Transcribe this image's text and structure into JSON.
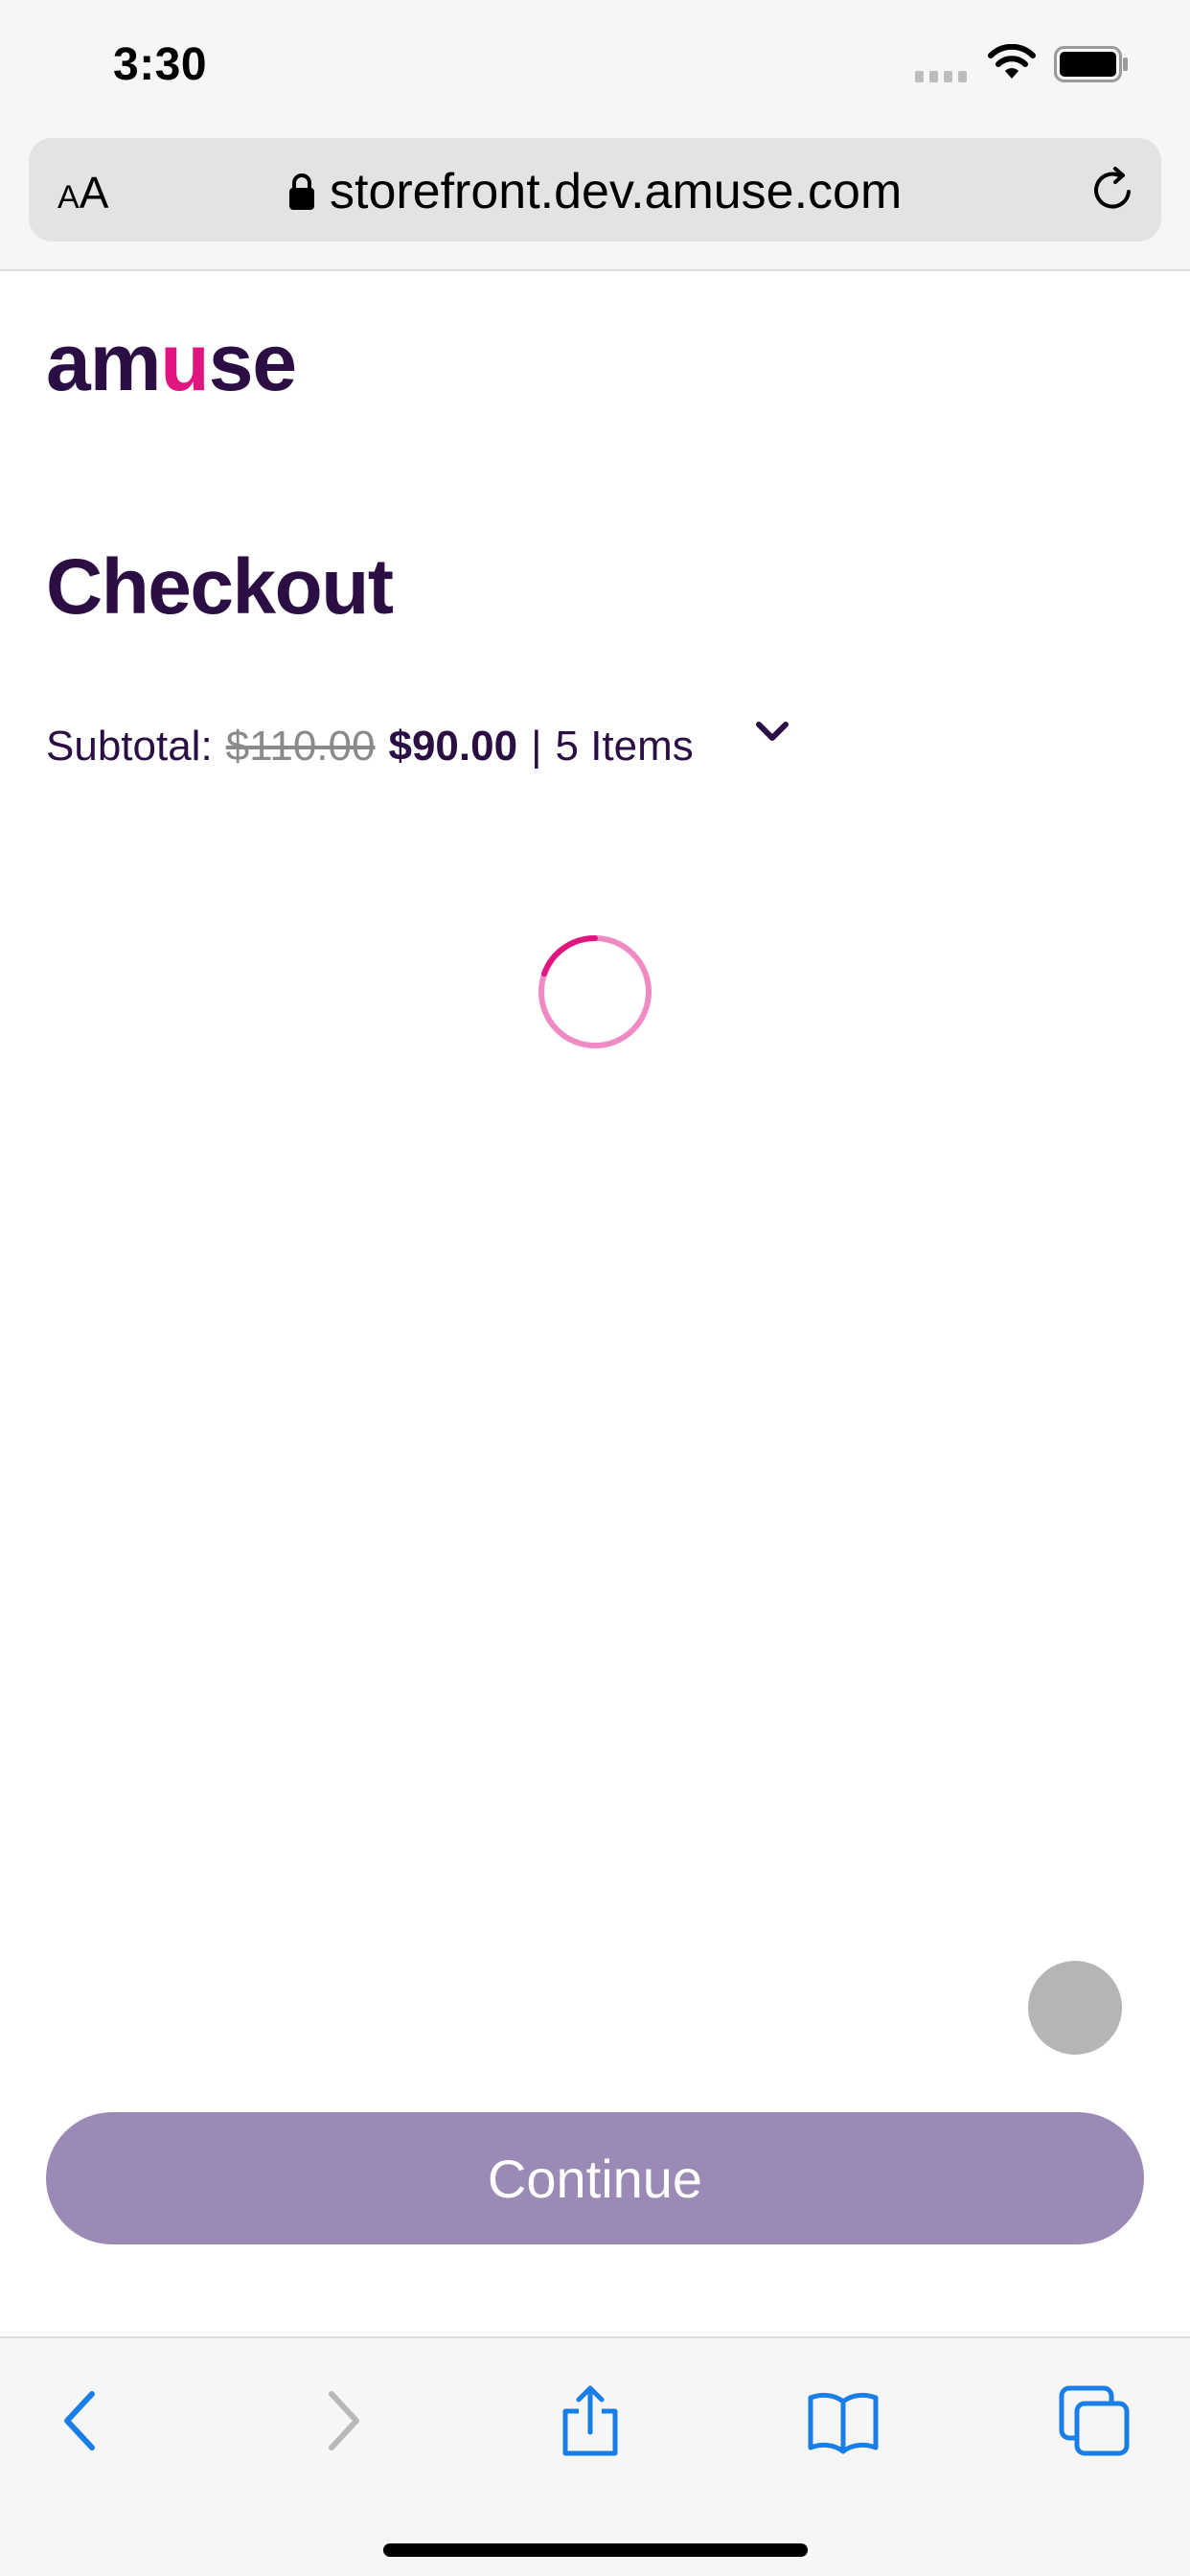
{
  "status_bar": {
    "time": "3:30",
    "icons": [
      "signal-icon",
      "wifi-icon",
      "battery-icon"
    ]
  },
  "browser": {
    "text_size_label": "AA",
    "url": "storefront.dev.amuse.com",
    "icons": [
      "lock-icon",
      "reload-icon"
    ]
  },
  "page": {
    "logo_text": "amuse",
    "title": "Checkout",
    "subtotal": {
      "label": "Subtotal:",
      "original_price": "$110.00",
      "sale_price": "$90.00",
      "separator": "|",
      "items": "5 Items"
    },
    "continue_label": "Continue"
  },
  "toolbar": {
    "icons": [
      "back-icon",
      "forward-icon",
      "share-icon",
      "bookmarks-icon",
      "tabs-icon"
    ]
  },
  "colors": {
    "brand_purple": "#2b0f44",
    "brand_pink": "#e0157f",
    "button_disabled": "#9b8ab5",
    "ios_blue": "#1a7ee8"
  }
}
